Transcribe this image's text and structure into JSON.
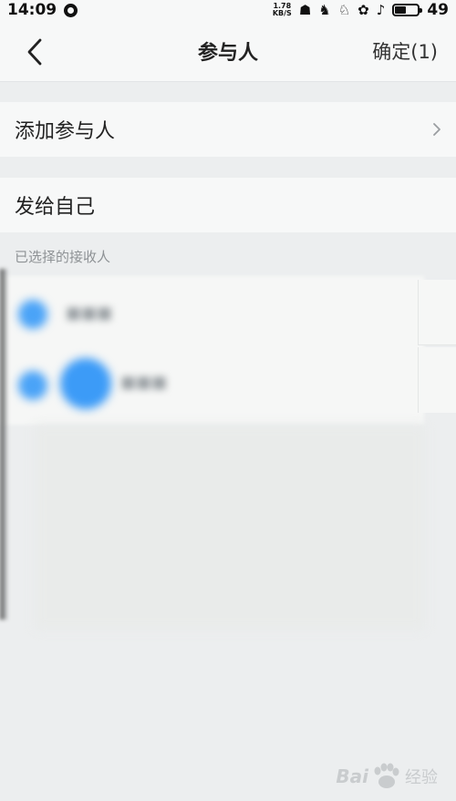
{
  "status_bar": {
    "time": "14:09",
    "net_speed_value": "1.78",
    "net_speed_unit": "KB/S",
    "battery_level": "49",
    "battery_fraction": 0.49
  },
  "nav": {
    "title": "参与人",
    "confirm_label": "确定(1)"
  },
  "rows": {
    "add_participant": "添加参与人",
    "send_to_self": "发给自己"
  },
  "recipients_section": {
    "label": "已选择的接收人"
  },
  "watermark": {
    "brand_left": "Bai",
    "brand_right": "经验"
  },
  "colors": {
    "accent": "#3c9bf7",
    "background": "#eceeef",
    "surface": "#f7f8f8"
  }
}
